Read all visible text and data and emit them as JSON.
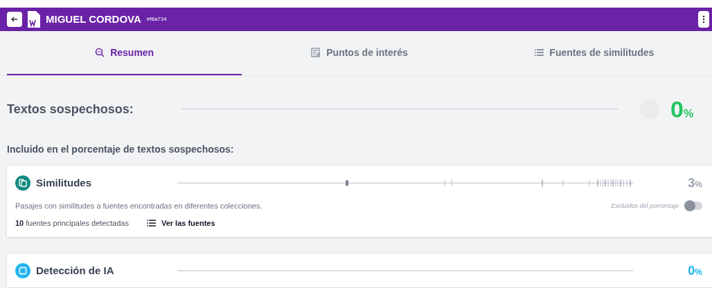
{
  "header": {
    "title": "MIGUEL CORDOVA",
    "id": "#f8a734"
  },
  "tabs": [
    {
      "label": "Resumen",
      "kind": "summary",
      "selected": true
    },
    {
      "label": "Puntos de interés",
      "kind": "highlights",
      "selected": false
    },
    {
      "label": "Fuentes de similitudes",
      "kind": "sources",
      "selected": false
    }
  ],
  "suspicious": {
    "label": "Textos sospechosos:",
    "value": "0",
    "unit": "%"
  },
  "section_title": "Incluido en el porcentaje de textos sospechosos:",
  "cards": [
    {
      "kind": "similarity",
      "title": "Similitudes",
      "value": "3",
      "unit": "%",
      "description": "Pasajes con similitudes a fuentes encontradas en diferentes colecciones.",
      "toggle_label": "Excluidos del porcentaje",
      "toggle_on": false,
      "sources_count": "10",
      "sources_text": "fuentes principales detectadas",
      "sources_link": "Ver las fuentes"
    },
    {
      "kind": "ai",
      "title": "Detección de IA",
      "value": "0",
      "unit": "%"
    }
  ]
}
